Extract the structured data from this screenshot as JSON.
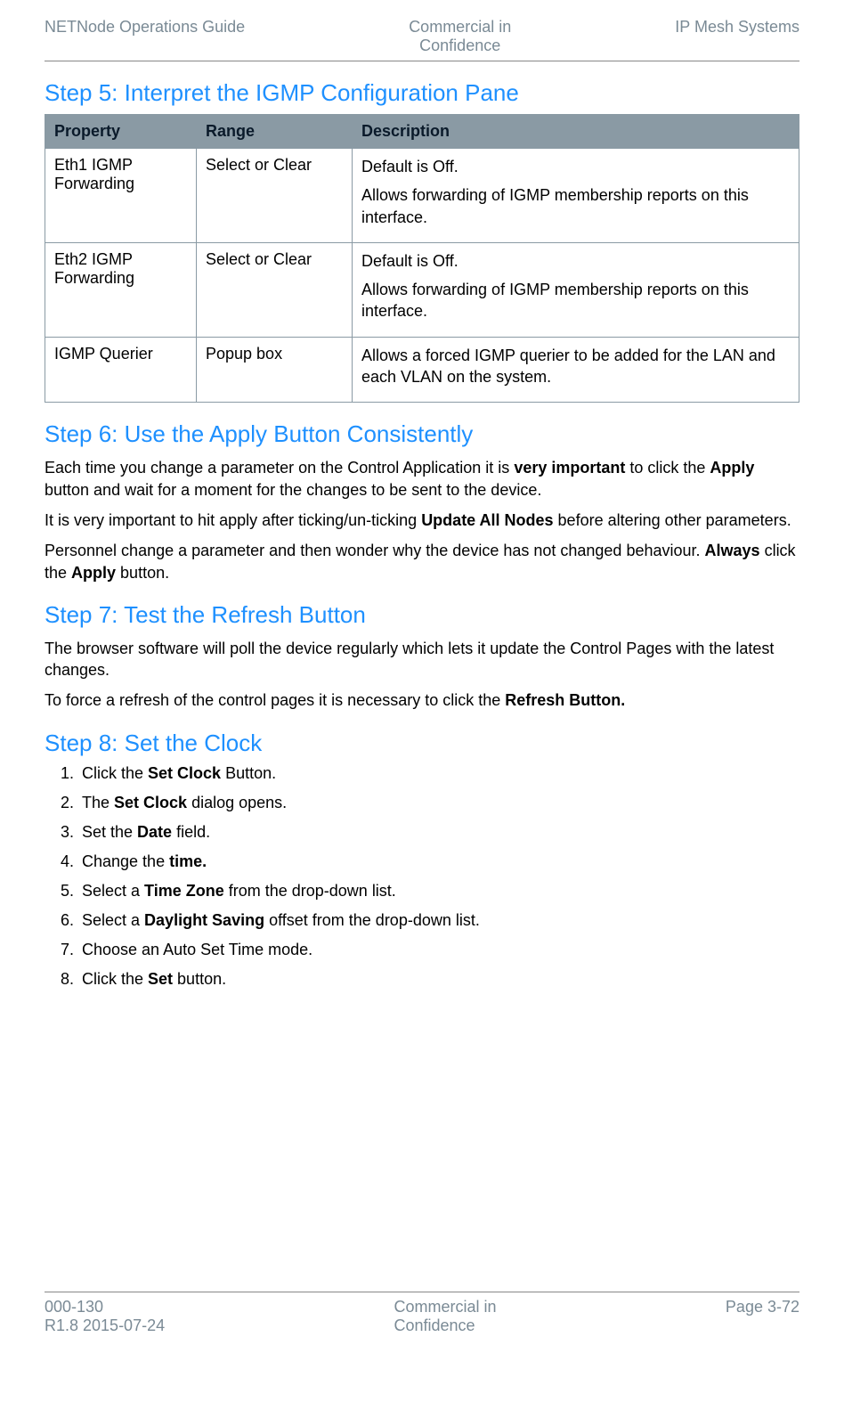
{
  "header": {
    "left": "NETNode Operations Guide",
    "center_line1": "Commercial in",
    "center_line2": "Confidence",
    "right": "IP Mesh Systems"
  },
  "step5": {
    "title": "Step 5: Interpret the IGMP Configuration Pane",
    "columns": {
      "c1": "Property",
      "c2": "Range",
      "c3": "Description"
    },
    "rows": [
      {
        "property": "Eth1 IGMP Forwarding",
        "range": "Select or Clear",
        "desc1": "Default is Off.",
        "desc2": "Allows forwarding of IGMP membership reports on this interface."
      },
      {
        "property": "Eth2 IGMP Forwarding",
        "range": "Select or Clear",
        "desc1": "Default is Off.",
        "desc2": "Allows forwarding of IGMP membership reports on this interface."
      },
      {
        "property": "IGMP Querier",
        "range": "Popup box",
        "desc1": "Allows a forced IGMP querier to be added for the LAN and each VLAN on the system.",
        "desc2": ""
      }
    ]
  },
  "step6": {
    "title": "Step 6: Use the Apply Button Consistently",
    "p1_pre": "Each time you change a parameter on the Control Application it is ",
    "p1_b1": "very important",
    "p1_mid": " to click the ",
    "p1_b2": "Apply",
    "p1_post": " button and wait for a moment for the changes to be sent to the device.",
    "p2_pre": "It is very important to hit apply after ticking/un-ticking ",
    "p2_b1": "Update All Nodes",
    "p2_post": " before altering other parameters.",
    "p3_pre": "Personnel change a parameter and then wonder why the device has not changed behaviour. ",
    "p3_b1": "Always",
    "p3_mid": " click the ",
    "p3_b2": "Apply",
    "p3_post": " button."
  },
  "step7": {
    "title": "Step 7: Test the Refresh Button",
    "p1": "The browser software will poll the device regularly which lets it update the Control Pages with the latest changes.",
    "p2_pre": "To force a refresh of the control pages it is necessary to click the ",
    "p2_b1": "Refresh Button."
  },
  "step8": {
    "title": "Step 8: Set the Clock",
    "items": [
      {
        "pre": "Click the ",
        "b": "Set Clock",
        "post": " Button."
      },
      {
        "pre": "The ",
        "b": "Set Clock",
        "post": " dialog opens."
      },
      {
        "pre": "Set the ",
        "b": "Date",
        "post": " field."
      },
      {
        "pre": "Change the ",
        "b": "time.",
        "post": ""
      },
      {
        "pre": "Select a ",
        "b": "Time Zone",
        "post": " from the drop-down list."
      },
      {
        "pre": "Select a ",
        "b": "Daylight Saving",
        "post": " offset from the drop-down list."
      },
      {
        "pre": "Choose an Auto Set Time mode.",
        "b": "",
        "post": ""
      },
      {
        "pre": "Click the ",
        "b": "Set",
        "post": " button."
      }
    ]
  },
  "footer": {
    "left_line1": "000-130",
    "left_line2": "R1.8 2015-07-24",
    "center_line1": "Commercial in",
    "center_line2": "Confidence",
    "right": "Page 3-72"
  }
}
